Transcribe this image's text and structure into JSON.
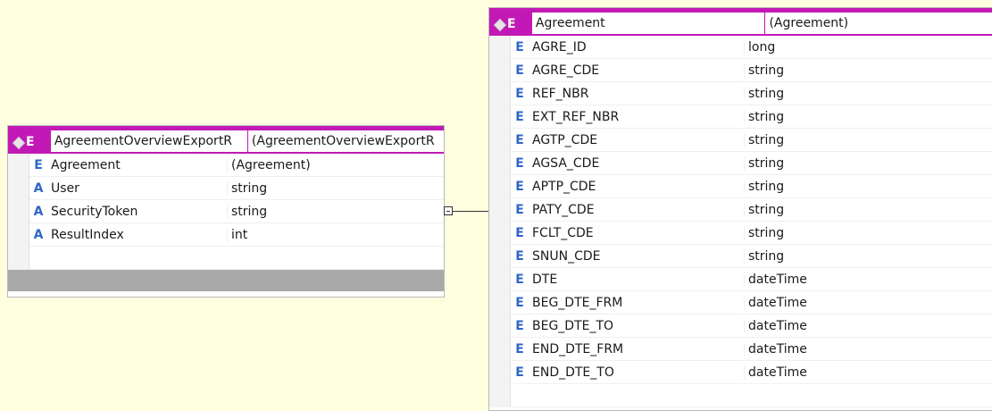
{
  "diagram": {
    "left_entity": {
      "badges": {
        "diamond": "◆",
        "type_letter": "E"
      },
      "title_name": "AgreementOverviewExportR",
      "title_type": "(AgreementOverviewExportR",
      "rows": [
        {
          "kind": "E",
          "name": "Agreement",
          "type": "(Agreement)"
        },
        {
          "kind": "A",
          "name": "User",
          "type": "string"
        },
        {
          "kind": "A",
          "name": "SecurityToken",
          "type": "string"
        },
        {
          "kind": "A",
          "name": "ResultIndex",
          "type": "int"
        }
      ]
    },
    "right_entity": {
      "badges": {
        "diamond": "◆",
        "type_letter": "E"
      },
      "title_name": "Agreement",
      "title_type": "(Agreement)",
      "rows": [
        {
          "kind": "E",
          "name": "AGRE_ID",
          "type": "long"
        },
        {
          "kind": "E",
          "name": "AGRE_CDE",
          "type": "string"
        },
        {
          "kind": "E",
          "name": "REF_NBR",
          "type": "string"
        },
        {
          "kind": "E",
          "name": "EXT_REF_NBR",
          "type": "string"
        },
        {
          "kind": "E",
          "name": "AGTP_CDE",
          "type": "string"
        },
        {
          "kind": "E",
          "name": "AGSA_CDE",
          "type": "string"
        },
        {
          "kind": "E",
          "name": "APTP_CDE",
          "type": "string"
        },
        {
          "kind": "E",
          "name": "PATY_CDE",
          "type": "string"
        },
        {
          "kind": "E",
          "name": "FCLT_CDE",
          "type": "string"
        },
        {
          "kind": "E",
          "name": "SNUN_CDE",
          "type": "string"
        },
        {
          "kind": "E",
          "name": "DTE",
          "type": "dateTime"
        },
        {
          "kind": "E",
          "name": "BEG_DTE_FRM",
          "type": "dateTime"
        },
        {
          "kind": "E",
          "name": "BEG_DTE_TO",
          "type": "dateTime"
        },
        {
          "kind": "E",
          "name": "END_DTE_FRM",
          "type": "dateTime"
        },
        {
          "kind": "E",
          "name": "END_DTE_TO",
          "type": "dateTime"
        }
      ]
    }
  },
  "colors": {
    "canvas_bg": "#FFFFE0",
    "title_accent": "#C219B6",
    "type_badge": "#2F66C7",
    "footer_bar": "#A9A9A9"
  }
}
